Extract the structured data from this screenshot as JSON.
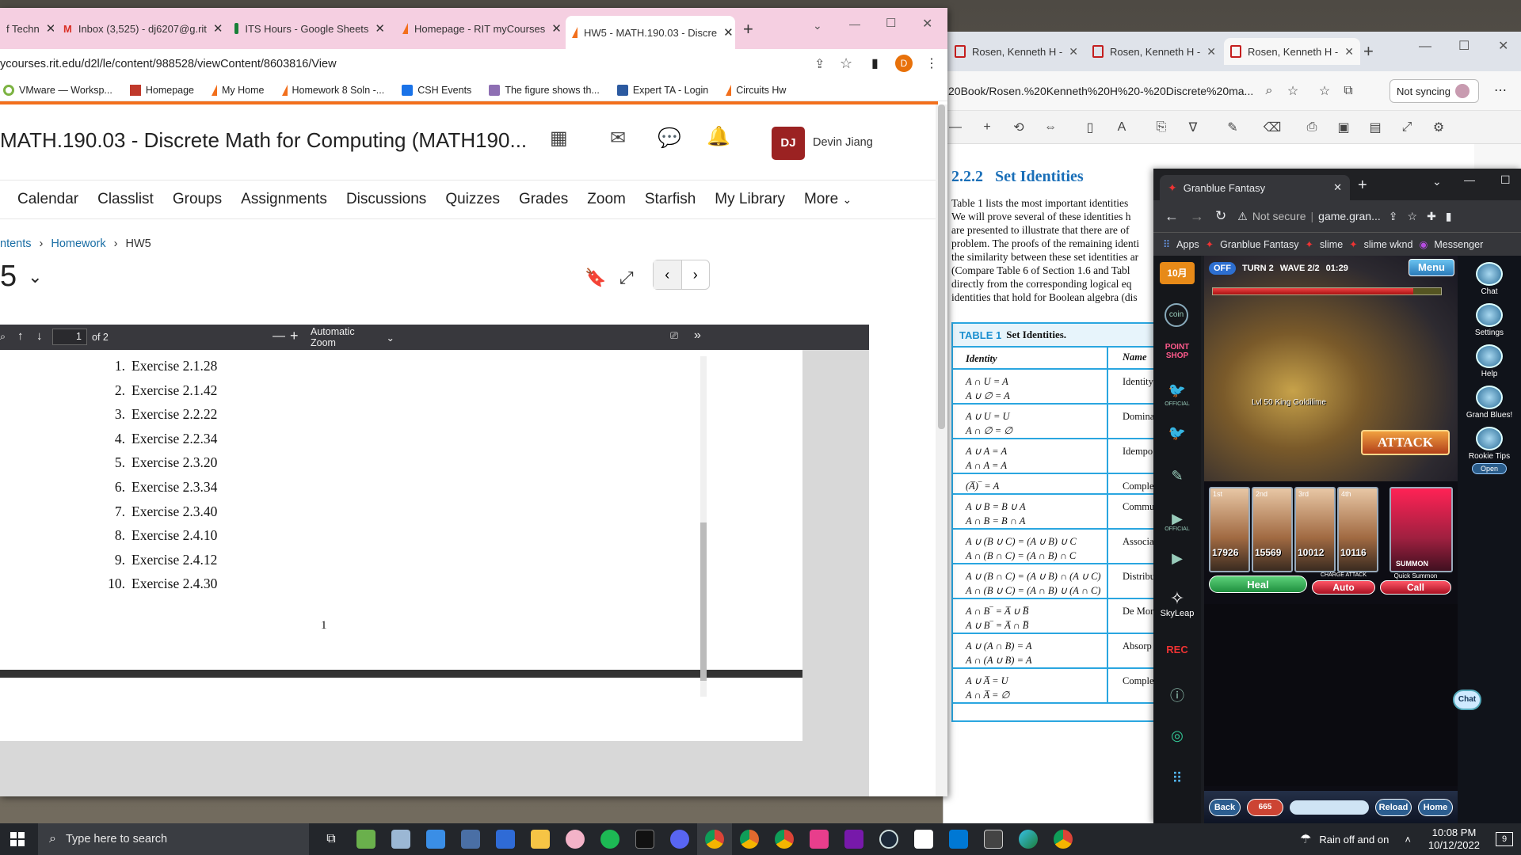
{
  "main_browser": {
    "tabs": [
      {
        "label": "f Techn",
        "icon": "rit-icon"
      },
      {
        "label": "Inbox (3,525) - dj6207@g.rit",
        "icon": "gmail-icon"
      },
      {
        "label": "ITS Hours - Google Sheets",
        "icon": "sheets-icon"
      },
      {
        "label": "Homepage - RIT myCourses",
        "icon": "d2l-icon"
      },
      {
        "label": "HW5 - MATH.190.03 - Discre",
        "icon": "d2l-icon"
      }
    ],
    "new_tab": "+",
    "url": "ycourses.rit.edu/d2l/le/content/988528/viewContent/8603816/View",
    "profile_letter": "D",
    "bookmarks": [
      "VMware — Worksp...",
      "Homepage",
      "My Home",
      "Homework 8 Soln -...",
      "CSH Events",
      "The figure shows th...",
      "Expert TA - Login",
      "Circuits Hw"
    ]
  },
  "d2l": {
    "course_title": "MATH.190.03 - Discrete Math for Computing (MATH190...",
    "user_initials": "DJ",
    "user_name": "Devin Jiang",
    "nav": [
      "Calendar",
      "Classlist",
      "Groups",
      "Assignments",
      "Discussions",
      "Quizzes",
      "Grades",
      "Zoom",
      "Starfish",
      "My Library",
      "More"
    ],
    "breadcrumb": [
      "ntents",
      "Homework",
      "HW5"
    ],
    "page_heading": "5",
    "pdf_viewer": {
      "page_input": "1",
      "page_total": "of 2",
      "zoom": "Automatic Zoom",
      "exercises": [
        {
          "n": "1.",
          "text": "Exercise 2.1.28"
        },
        {
          "n": "2.",
          "text": "Exercise 2.1.42"
        },
        {
          "n": "3.",
          "text": "Exercise 2.2.22"
        },
        {
          "n": "4.",
          "text": "Exercise 2.2.34"
        },
        {
          "n": "5.",
          "text": "Exercise 2.3.20"
        },
        {
          "n": "6.",
          "text": "Exercise 2.3.34"
        },
        {
          "n": "7.",
          "text": "Exercise 2.3.40"
        },
        {
          "n": "8.",
          "text": "Exercise 2.4.10"
        },
        {
          "n": "9.",
          "text": "Exercise 2.4.12"
        },
        {
          "n": "10.",
          "text": "Exercise 2.4.30"
        }
      ],
      "page_number": "1"
    }
  },
  "edge_browser": {
    "tabs": [
      "Rosen, Kenneth H -",
      "Rosen, Kenneth H -",
      "Rosen, Kenneth H -"
    ],
    "url": "20Book/Rosen.%20Kenneth%20H%20-%20Discrete%20ma...",
    "sync_label": "Not syncing",
    "pdf": {
      "section": "2.2.2",
      "section_title": "Set Identities",
      "paragraph": [
        "Table 1 lists the most important identities",
        "We will prove several of these identities h",
        "are presented to illustrate that there are of",
        "problem. The proofs of the remaining identi",
        "the similarity between these set identities ar",
        "(Compare Table 6 of Section 1.6 and Tabl",
        "directly from the corresponding logical eq",
        "identities that hold for Boolean algebra (dis"
      ],
      "table_label": "TABLE 1",
      "table_title": "Set Identities.",
      "col_identity": "Identity",
      "col_name": "Name",
      "rows": [
        {
          "lines": [
            "A ∩ U = A",
            "A ∪ ∅ = A"
          ],
          "name": "Identity"
        },
        {
          "lines": [
            "A ∪ U = U",
            "A ∩ ∅ = ∅"
          ],
          "name": "Domina"
        },
        {
          "lines": [
            "A ∪ A = A",
            "A ∩ A = A"
          ],
          "name": "Idempo"
        },
        {
          "lines": [
            "(A̅)‾ = A"
          ],
          "name": "Comple"
        },
        {
          "lines": [
            "A ∪ B = B ∪ A",
            "A ∩ B = B ∩ A"
          ],
          "name": "Commu"
        },
        {
          "lines": [
            "A ∪ (B ∪ C) = (A ∪ B) ∪ C",
            "A ∩ (B ∩ C) = (A ∩ B) ∩ C"
          ],
          "name": "Associa"
        },
        {
          "lines": [
            "A ∪ (B ∩ C) = (A ∪ B) ∩ (A ∪ C)",
            "A ∩ (B ∪ C) = (A ∩ B) ∪ (A ∩ C)"
          ],
          "name": "Distribu"
        },
        {
          "lines": [
            "A ∩ B‾ = A̅ ∪ B̅",
            "A ∪ B‾ = A̅ ∩ B̅"
          ],
          "name": "De Mor"
        },
        {
          "lines": [
            "A ∪ (A ∩ B) = A",
            "A ∩ (A ∪ B) = A"
          ],
          "name": "Absorp"
        },
        {
          "lines": [
            "A ∪ A̅ = U",
            "A ∩ A̅ = ∅"
          ],
          "name": "Comple"
        }
      ]
    }
  },
  "gbf_browser": {
    "tab_title": "Granblue Fantasy",
    "url_warning": "Not secure",
    "url": "game.gran...",
    "bookmarks": [
      "Apps",
      "Granblue Fantasy",
      "slime",
      "slime wknd",
      "Messenger"
    ],
    "side_labels": [
      "POINT SHOP",
      "OFFICIAL",
      "OFFICIAL",
      "SkyLeap",
      "REC"
    ],
    "game": {
      "auto_state": "OFF",
      "turn": "TURN 2",
      "wave": "WAVE 2/2",
      "timer": "01:29",
      "menu": "Menu",
      "boss": "Lvl 50 King Goldilime",
      "attack": "ATTACK",
      "hp_values": [
        "17926",
        "15569",
        "10012",
        "10116"
      ],
      "party_tags": [
        "1st",
        "2nd",
        "3rd",
        "4th"
      ],
      "summon": "SUMMON",
      "heal": "Heal",
      "charge_attack_label": "CHARGE ATTACK",
      "charge_attack_value": "Auto",
      "quick_summon_label": "Quick Summon",
      "quick_summon_value": "Call",
      "bottom": [
        "Back",
        "665",
        "Reload",
        "Home"
      ]
    },
    "right_menu": [
      "Chat",
      "Settings",
      "Help",
      "Grand Blues!",
      "Rookie Tips",
      "Open"
    ],
    "chat_bubble": "Chat"
  },
  "taskbar": {
    "search_placeholder": "Type here to search",
    "weather": "Rain off and on",
    "time": "10:08 PM",
    "date": "10/12/2022",
    "notification_count": "9"
  },
  "colors": {
    "d2l_orange": "#f26f1c",
    "chrome_tabbar": "#f5cfe1",
    "avatar": "#9b2222",
    "table_blue": "#2aa6e0",
    "link_blue": "#1a6ea5"
  }
}
